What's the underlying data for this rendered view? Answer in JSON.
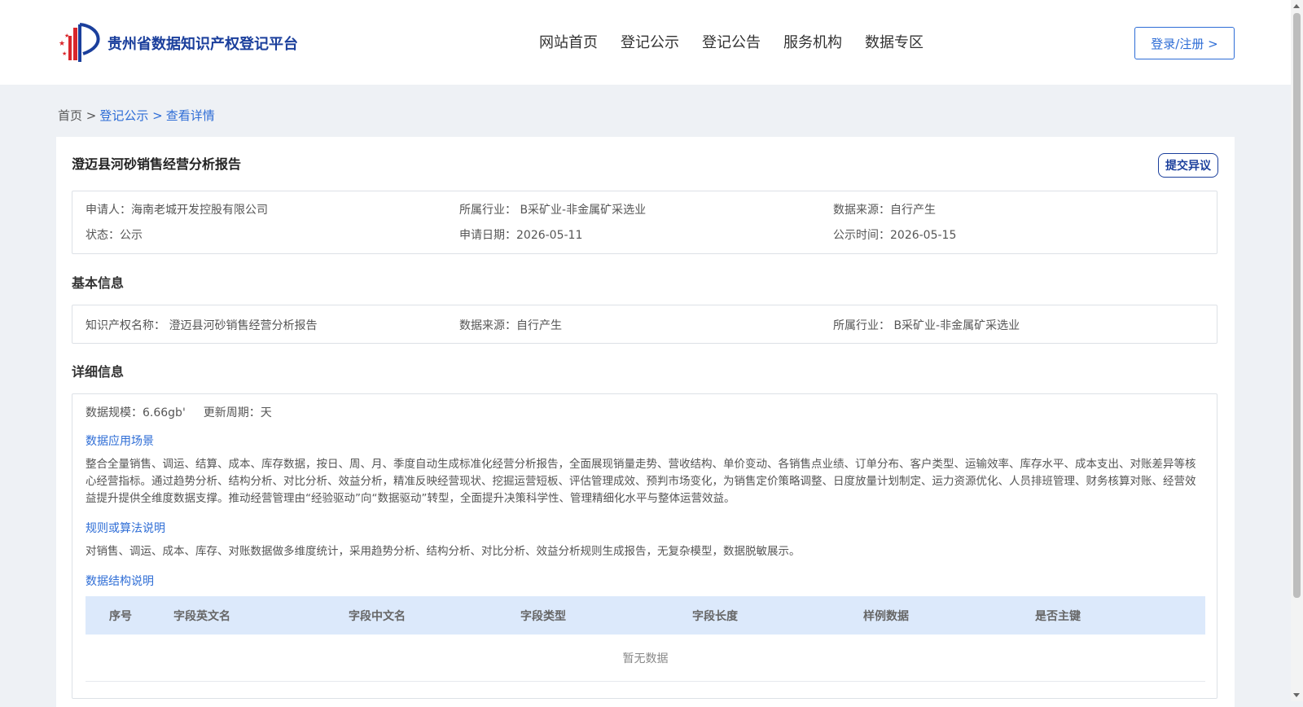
{
  "header": {
    "logo_text": "贵州省数据知识产权登记平台",
    "nav": [
      "网站首页",
      "登记公示",
      "登记公告",
      "服务机构",
      "数据专区"
    ],
    "login_label": "登录/注册 >"
  },
  "breadcrumb": {
    "home": "首页 >",
    "level1": "登记公示 >",
    "level2": "查看详情"
  },
  "record": {
    "title": "澄迈县河砂销售经营分析报告",
    "objection_label": "提交异议",
    "summary": {
      "applicant": "申请人：海南老城开发控股有限公司",
      "industry": "所属行业： B采矿业-非金属矿采选业",
      "source": "数据来源：自行产生",
      "status": "状态：公示",
      "apply_date": "申请日期：2026-05-11",
      "publish_time": "公示时间：2026-05-15"
    }
  },
  "basic_info": {
    "heading": "基本信息",
    "ip_name": "知识产权名称： 澄迈县河砂销售经营分析报告",
    "source": "数据来源：自行产生",
    "industry": "所属行业： B采矿业-非金属矿采选业"
  },
  "detail_info": {
    "heading": "详细信息",
    "scale": "数据规模：6.66gb'",
    "cycle": "更新周期：天",
    "scenario_title": "数据应用场景",
    "scenario_text": "整合全量销售、调运、结算、成本、库存数据，按日、周、月、季度自动生成标准化经营分析报告，全面展现销量走势、营收结构、单价变动、各销售点业绩、订单分布、客户类型、运输效率、库存水平、成本支出、对账差异等核心经营指标。通过趋势分析、结构分析、对比分析、效益分析，精准反映经营现状、挖掘运营短板、评估管理成效、预判市场变化，为销售定价策略调整、日度放量计划制定、运力资源优化、人员排班管理、财务核算对账、经营效益提升提供全维度数据支撑。推动经营管理由“经验驱动”向“数据驱动”转型，全面提升决策科学性、管理精细化水平与整体运营效益。",
    "algorithm_title": "规则或算法说明",
    "algorithm_text": "对销售、调运、成本、库存、对账数据做多维度统计，采用趋势分析、结构分析、对比分析、效益分析规则生成报告，无复杂模型，数据脱敏展示。",
    "structure_title": "数据结构说明",
    "table": {
      "columns": [
        "序号",
        "字段英文名",
        "字段中文名",
        "字段类型",
        "字段长度",
        "样例数据",
        "是否主键"
      ],
      "empty_text": "暂无数据"
    }
  },
  "colors": {
    "brand": "#1b3f9c",
    "link": "#2e6dd6",
    "table_header": "#dce9fb",
    "page_bg": "#eef1f5"
  }
}
